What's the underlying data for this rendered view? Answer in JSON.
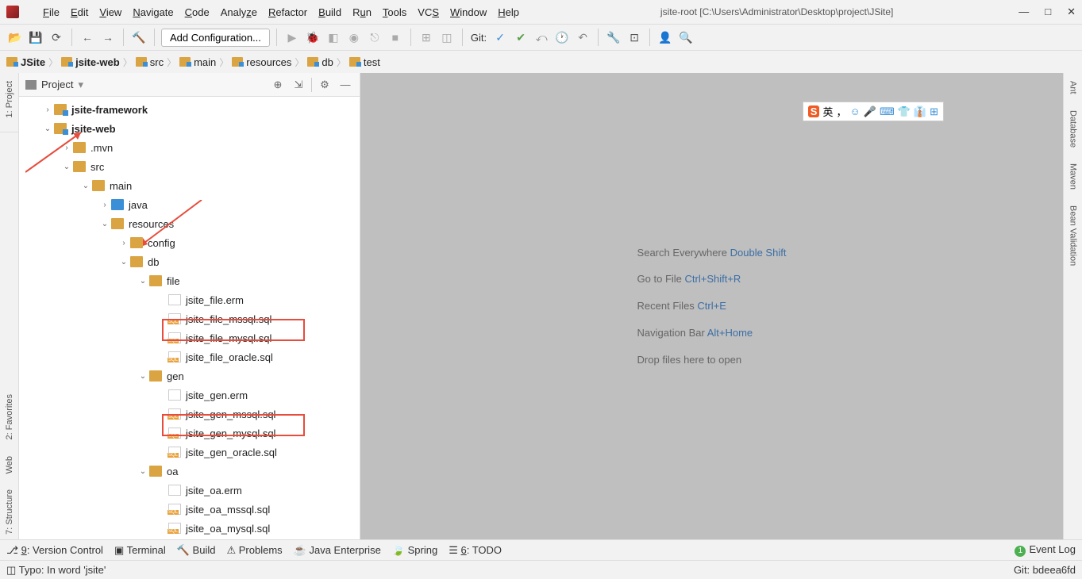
{
  "title": "jsite-root [C:\\Users\\Administrator\\Desktop\\project\\JSite]",
  "menu": [
    "File",
    "Edit",
    "View",
    "Navigate",
    "Code",
    "Analyze",
    "Refactor",
    "Build",
    "Run",
    "Tools",
    "VCS",
    "Window",
    "Help"
  ],
  "toolbar": {
    "add_config": "Add Configuration...",
    "git_label": "Git:"
  },
  "breadcrumb": [
    "JSite",
    "jsite-web",
    "src",
    "main",
    "resources",
    "db",
    "test"
  ],
  "project_label": "Project",
  "tree": {
    "n0": "jsite-framework",
    "n1": "jsite-web",
    "n2": ".mvn",
    "n3": "src",
    "n4": "main",
    "n5": "java",
    "n6": "resources",
    "n7": "config",
    "n8": "db",
    "n9": "file",
    "n10": "jsite_file.erm",
    "n11": "jsite_file_mssql.sql",
    "n12": "jsite_file_mysql.sql",
    "n13": "jsite_file_oracle.sql",
    "n14": "gen",
    "n15": "jsite_gen.erm",
    "n16": "jsite_gen_mssql.sql",
    "n17": "jsite_gen_mysql.sql",
    "n18": "jsite_gen_oracle.sql",
    "n19": "oa",
    "n20": "jsite_oa.erm",
    "n21": "jsite_oa_mssql.sql",
    "n22": "jsite_oa_mysql.sql"
  },
  "welcome": {
    "l1a": "Search Everywhere ",
    "l1b": "Double Shift",
    "l2a": "Go to File ",
    "l2b": "Ctrl+Shift+R",
    "l3a": "Recent Files ",
    "l3b": "Ctrl+E",
    "l4a": "Navigation Bar ",
    "l4b": "Alt+Home",
    "l5": "Drop files here to open"
  },
  "ime": [
    "英",
    "，",
    "☺",
    "🎤",
    "⌨",
    "👕",
    "👔",
    "⊞"
  ],
  "left_gutter": [
    "1: Project",
    "2: Favorites",
    "Web",
    "7: Structure"
  ],
  "right_gutter": [
    "Ant",
    "Database",
    "Maven",
    "Bean Validation"
  ],
  "bottom": {
    "version_control": "9: Version Control",
    "terminal": "Terminal",
    "build": "Build",
    "problems": "Problems",
    "java_ee": "Java Enterprise",
    "spring": "Spring",
    "todo": "6: TODO",
    "event_log": "Event Log"
  },
  "status": {
    "msg": "Typo: In word 'jsite'",
    "git": "Git: bdeea6fd"
  }
}
